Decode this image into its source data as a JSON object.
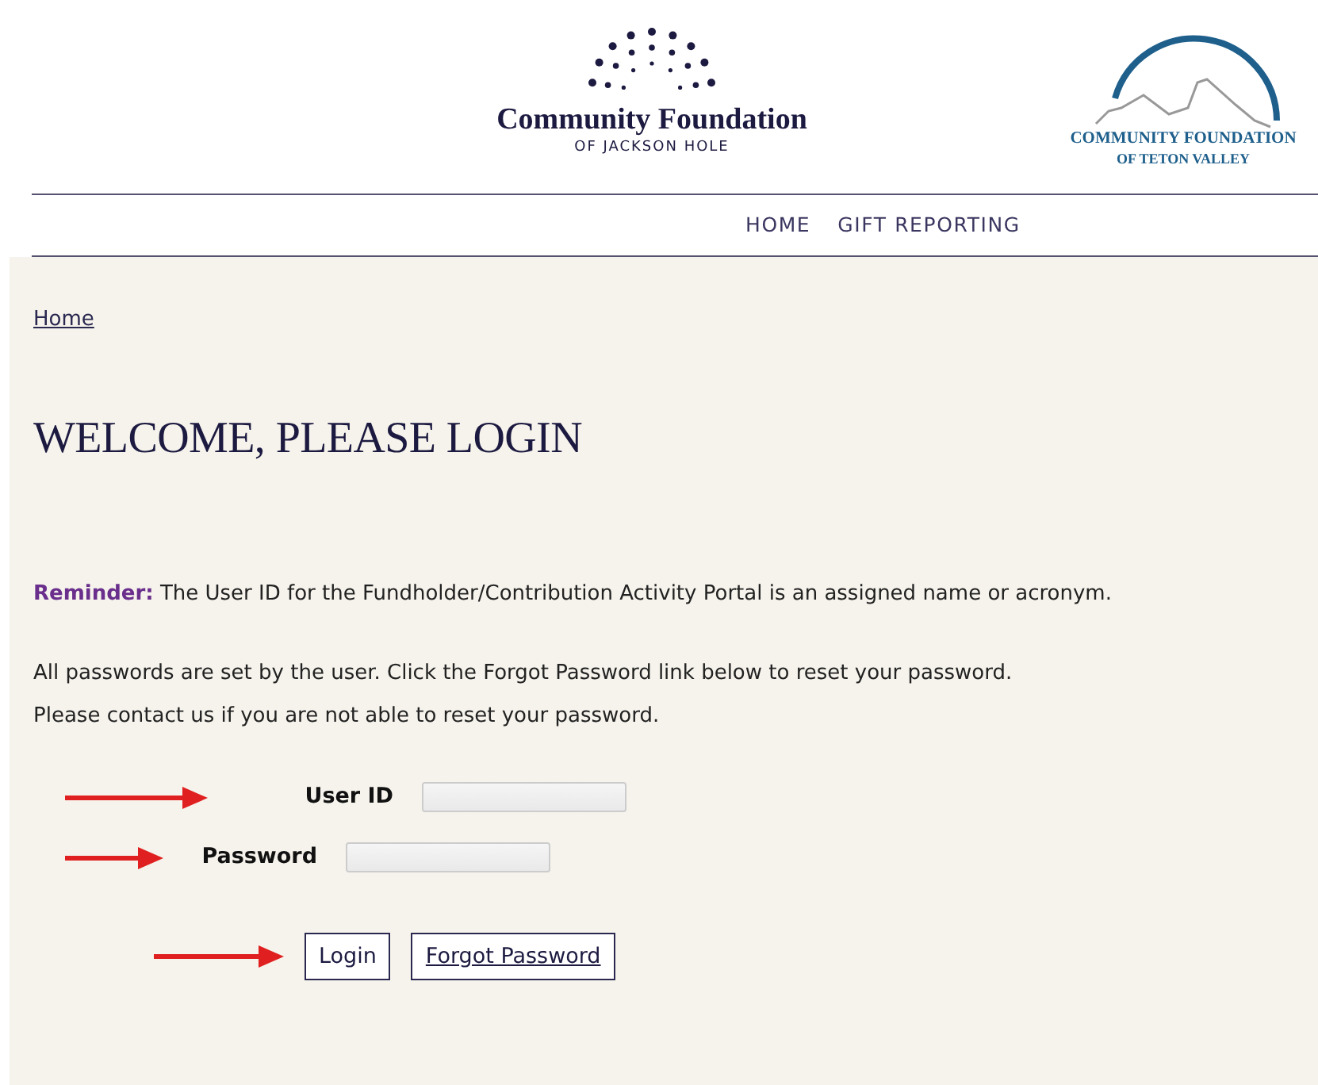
{
  "logos": [
    {
      "kind": "dots",
      "name": "Community Foundation",
      "subtitle": "OF JACKSON HOLE"
    },
    {
      "kind": "mountain",
      "name": "COMMUNITY FOUNDATION",
      "subtitle": "OF TETON VALLEY"
    }
  ],
  "nav": [
    {
      "label": "HOME"
    },
    {
      "label": "GIFT REPORTING"
    }
  ],
  "breadcrumb": "Home",
  "heading": "WELCOME, PLEASE LOGIN",
  "reminder": {
    "label": "Reminder:",
    "text": "The User ID for the Fundholder/Contribution Activity Portal is an assigned name or acronym."
  },
  "paragraphs": [
    "All passwords are set by the user. Click the Forgot Password link below to reset your password.",
    "Please contact us if you are not able to reset your password."
  ],
  "fields": [
    {
      "label": "User ID"
    },
    {
      "label": "Password"
    }
  ],
  "buttons": [
    {
      "label": "Login",
      "kind": "submit"
    },
    {
      "label": "Forgot Password",
      "kind": "link"
    }
  ]
}
